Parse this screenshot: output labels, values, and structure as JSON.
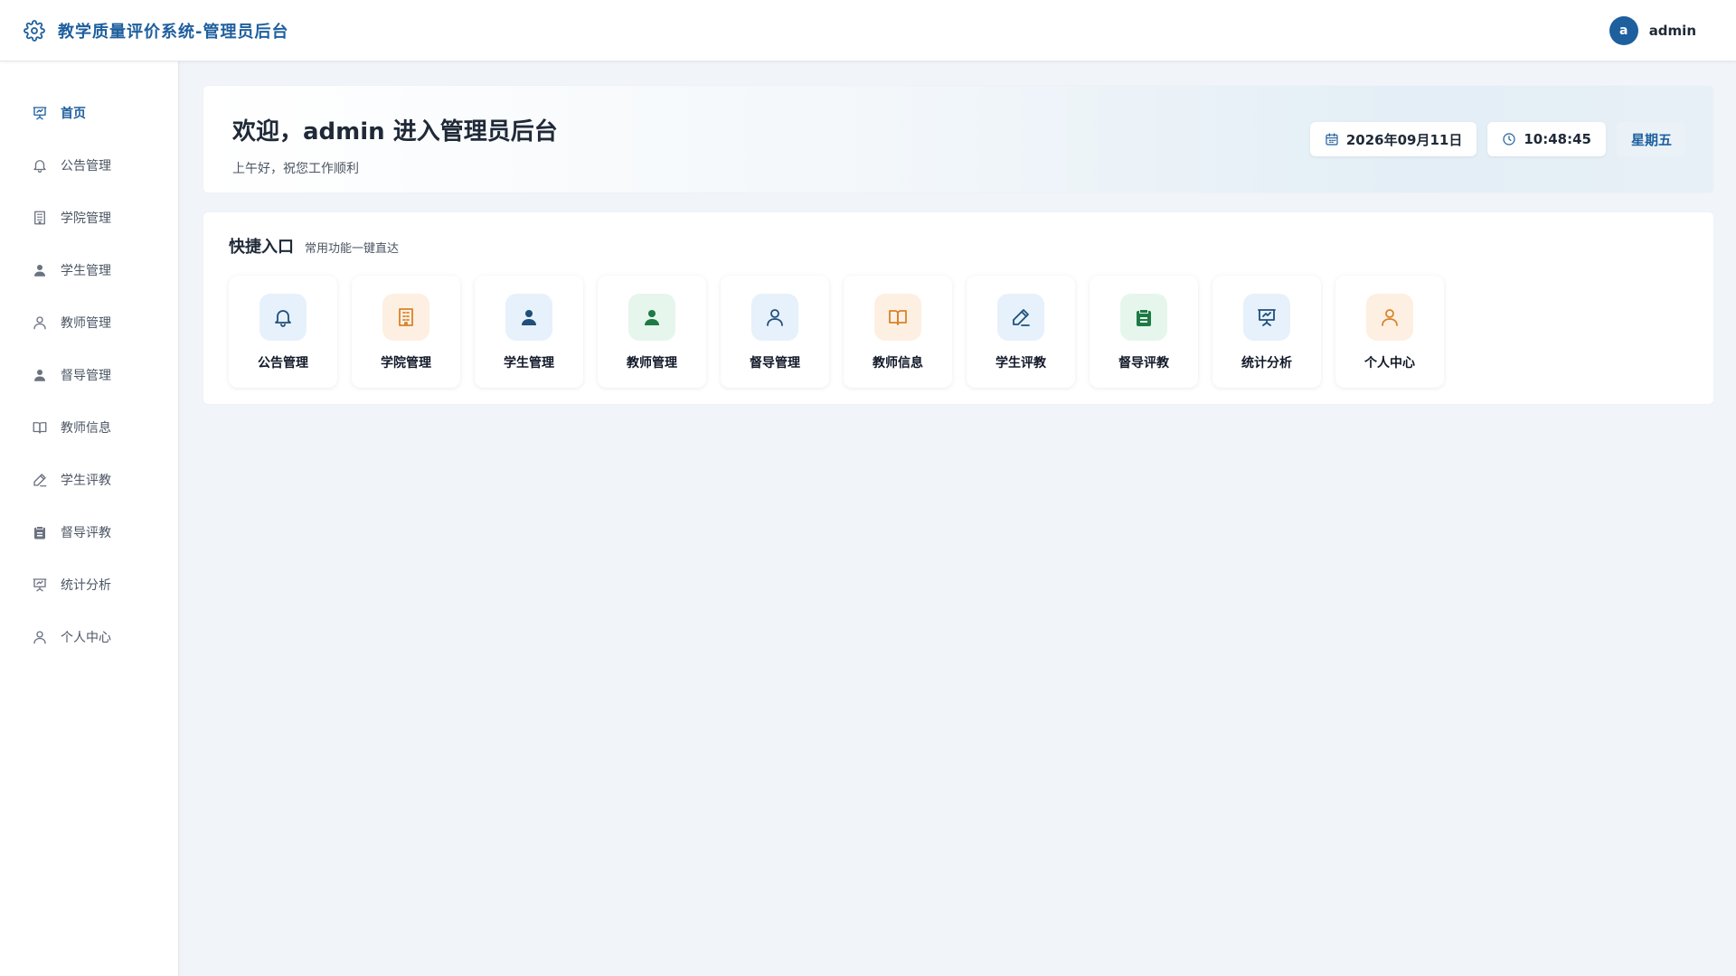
{
  "header": {
    "title": "教学质量评价系统-管理员后台",
    "avatar_letter": "a",
    "username": "admin"
  },
  "sidebar": {
    "items": [
      {
        "label": "首页",
        "icon": "presentation-chart-icon",
        "active": true
      },
      {
        "label": "公告管理",
        "icon": "bell-icon"
      },
      {
        "label": "学院管理",
        "icon": "building-icon"
      },
      {
        "label": "学生管理",
        "icon": "user-filled-icon"
      },
      {
        "label": "教师管理",
        "icon": "user-outline-icon"
      },
      {
        "label": "督导管理",
        "icon": "user-filled-icon"
      },
      {
        "label": "教师信息",
        "icon": "book-icon"
      },
      {
        "label": "学生评教",
        "icon": "pen-icon"
      },
      {
        "label": "督导评教",
        "icon": "clipboard-icon"
      },
      {
        "label": "统计分析",
        "icon": "presentation-chart-icon"
      },
      {
        "label": "个人中心",
        "icon": "user-outline-icon"
      }
    ]
  },
  "welcome": {
    "title": "欢迎，admin 进入管理员后台",
    "subtitle": "上午好，祝您工作顺利",
    "date": "2026年09月11日",
    "time": "10:48:45",
    "weekday": "星期五"
  },
  "quick": {
    "title": "快捷入口",
    "subtitle": "常用功能一键直达",
    "cards": [
      {
        "label": "公告管理",
        "icon": "bell-icon",
        "tone": "blue"
      },
      {
        "label": "学院管理",
        "icon": "building-icon",
        "tone": "orange"
      },
      {
        "label": "学生管理",
        "icon": "user-filled-icon",
        "tone": "blue"
      },
      {
        "label": "教师管理",
        "icon": "user-filled-icon",
        "tone": "green"
      },
      {
        "label": "督导管理",
        "icon": "user-outline-icon",
        "tone": "blue"
      },
      {
        "label": "教师信息",
        "icon": "book-icon",
        "tone": "orange"
      },
      {
        "label": "学生评教",
        "icon": "pen-icon",
        "tone": "blue"
      },
      {
        "label": "督导评教",
        "icon": "clipboard-icon",
        "tone": "green"
      },
      {
        "label": "统计分析",
        "icon": "presentation-chart-icon",
        "tone": "blue"
      },
      {
        "label": "个人中心",
        "icon": "user-outline-icon",
        "tone": "orange"
      }
    ]
  },
  "colors": {
    "primary": "#1e5f9e",
    "background": "#f1f5f9",
    "orange": "#d9822b",
    "green": "#1e7a45"
  }
}
